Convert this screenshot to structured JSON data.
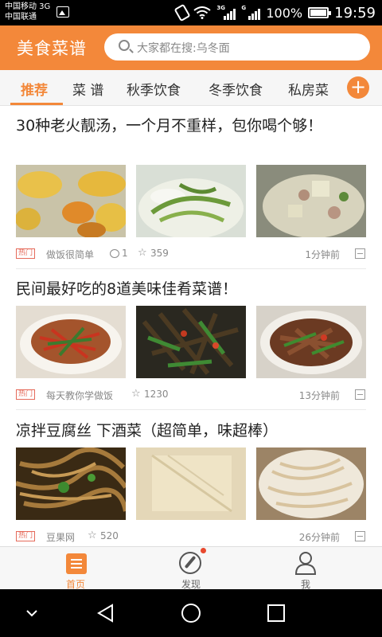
{
  "status_bar": {
    "carrier_1": "中国移动 3G",
    "carrier_2": "中国联通",
    "net_tag_1": "3G",
    "net_tag_2": "G",
    "battery": "100%",
    "time": "19:59",
    "icons": [
      "gallery-icon",
      "vibrate-icon",
      "wifi-icon",
      "signal-icon",
      "battery-icon"
    ]
  },
  "header": {
    "title": "美食菜谱",
    "search_placeholder": "大家都在搜:乌冬面",
    "accent_color": "#f3883a"
  },
  "tabs": [
    {
      "label": "推荐",
      "active": true
    },
    {
      "label": "菜 谱",
      "active": false
    },
    {
      "label": "秋季饮食",
      "active": false
    },
    {
      "label": "冬季饮食",
      "active": false
    },
    {
      "label": "私房菜",
      "active": false
    }
  ],
  "add_button": "+",
  "articles": [
    {
      "title": "30种老火靓汤，一个月不重样，包你喝个够！",
      "badge": "热门",
      "author": "做饭很简单",
      "comments": "1",
      "favorites": "359",
      "time": "1分钟前"
    },
    {
      "title": "民间最好吃的8道美味佳肴菜谱！",
      "badge": "热门",
      "author": "每天教你学做饭",
      "favorites": "1230",
      "time": "13分钟前"
    },
    {
      "title": "凉拌豆腐丝 下酒菜（超简单，味超棒）",
      "badge": "热门",
      "author": "豆果网",
      "favorites": "520",
      "time": "26分钟前"
    }
  ],
  "bottom_nav": [
    {
      "label": "首页",
      "icon": "home-icon",
      "active": true
    },
    {
      "label": "发现",
      "icon": "compass-icon",
      "active": false
    },
    {
      "label": "我",
      "icon": "person-icon",
      "active": false
    }
  ],
  "system_nav": [
    "down-chevron-icon",
    "back-icon",
    "home-circle-icon",
    "recents-icon"
  ]
}
